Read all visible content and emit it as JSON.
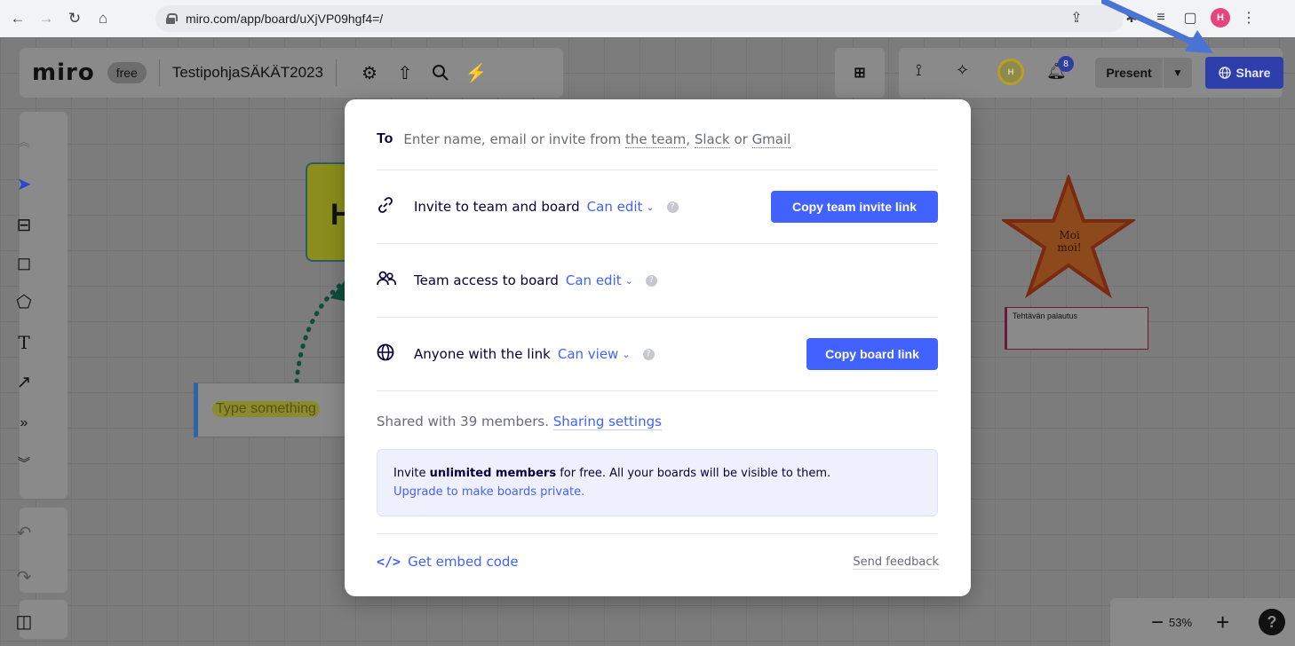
{
  "browser": {
    "url": "miro.com/app/board/uXjVP09hgf4=/",
    "profile_initial": "H"
  },
  "toolbar": {
    "logo": "miro",
    "plan": "free",
    "board_name": "TestipohjaSÄKÄT2023",
    "collaborator_initial": "H",
    "notification_count": "8",
    "present_label": "Present",
    "share_label": "Share"
  },
  "canvas": {
    "sticky_letter": "H",
    "type_placeholder": "Type something",
    "star_text_line1": "Moi",
    "star_text_line2": "moi!",
    "card_title": "Tehtävän palautus",
    "zoom_level": "53%"
  },
  "share_modal": {
    "to_label": "To",
    "to_placeholder_prefix": "Enter name, email or invite from ",
    "to_link_team": "the team",
    "to_sep1": ", ",
    "to_link_slack": "Slack",
    "to_sep2": " or ",
    "to_link_gmail": "Gmail",
    "invite_team_label": "Invite to team and board",
    "invite_team_level": "Can edit",
    "copy_team_invite": "Copy team invite link",
    "team_access_label": "Team access to board",
    "team_access_level": "Can edit",
    "anyone_label": "Anyone with the link",
    "anyone_level": "Can view",
    "copy_board_link": "Copy board link",
    "shared_with": "Shared with 39 members.",
    "sharing_settings": "Sharing settings",
    "info_prefix": "Invite ",
    "info_bold": "unlimited members",
    "info_suffix": " for free. All your boards will be visible to them.",
    "info_upgrade": "Upgrade to make boards private.",
    "embed_label": "Get embed code",
    "feedback_label": "Send feedback"
  },
  "colors": {
    "accent": "#4262ff",
    "share_button": "#2e3fab",
    "text_primary": "#050038"
  }
}
